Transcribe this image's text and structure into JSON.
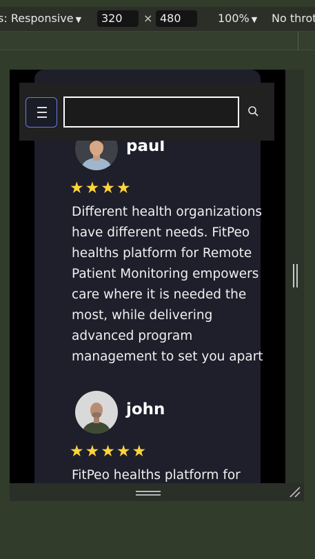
{
  "devtools": {
    "device_label": "s: Responsive",
    "width_value": "320",
    "times": "×",
    "height_value": "480",
    "zoom": "100%",
    "throttle": "No throt"
  },
  "page": {
    "navbar": {
      "menu_icon": "hamburger-menu-icon",
      "search_placeholder": "",
      "search_icon": "magnifier-search-icon"
    },
    "reviews": [
      {
        "name": "paul",
        "stars": 4,
        "text": "Different health organizations have different needs. FitPeo healths platform for Remote Patient Monitoring empowers care where it is needed the most, while delivering advanced program management to set you apart"
      },
      {
        "name": "john",
        "stars": 5,
        "text": "FitPeo healths platform for"
      }
    ],
    "colors": {
      "card_bg": "#1e1f2b",
      "star": "#ffd43b",
      "menu_border": "#6b7de0"
    }
  }
}
